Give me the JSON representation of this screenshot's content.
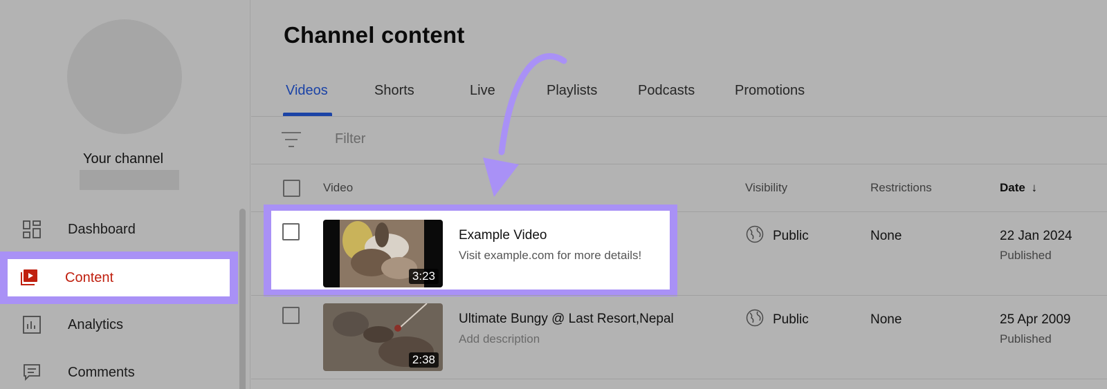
{
  "sidebar": {
    "channel_name": "Your channel",
    "items": [
      {
        "label": "Dashboard",
        "icon": "dashboard-icon"
      },
      {
        "label": "Content",
        "icon": "content-icon",
        "active": true
      },
      {
        "label": "Analytics",
        "icon": "analytics-icon"
      },
      {
        "label": "Comments",
        "icon": "comments-icon"
      }
    ]
  },
  "header": {
    "title": "Channel content"
  },
  "tabs": [
    {
      "label": "Videos",
      "active": true
    },
    {
      "label": "Shorts"
    },
    {
      "label": "Live"
    },
    {
      "label": "Playlists"
    },
    {
      "label": "Podcasts"
    },
    {
      "label": "Promotions"
    }
  ],
  "filter": {
    "placeholder": "Filter",
    "icon": "filter-icon"
  },
  "table": {
    "columns": [
      "Video",
      "Visibility",
      "Restrictions",
      "Date"
    ],
    "sort_indicator": "↓",
    "rows": [
      {
        "title": "Example Video",
        "description": "Visit example.com for more details!",
        "duration": "3:23",
        "visibility": "Public",
        "restrictions": "None",
        "date": "22 Jan 2024",
        "status": "Published"
      },
      {
        "title": "Ultimate Bungy @ Last Resort,Nepal",
        "description": "Add description",
        "duration": "2:38",
        "visibility": "Public",
        "restrictions": "None",
        "date": "25 Apr 2009",
        "status": "Published"
      }
    ]
  },
  "colors": {
    "highlight": "#a991f6",
    "accent_blue": "#1b43a6",
    "active_red": "#c0200f",
    "overlay_gray": "#b3b3b3"
  }
}
